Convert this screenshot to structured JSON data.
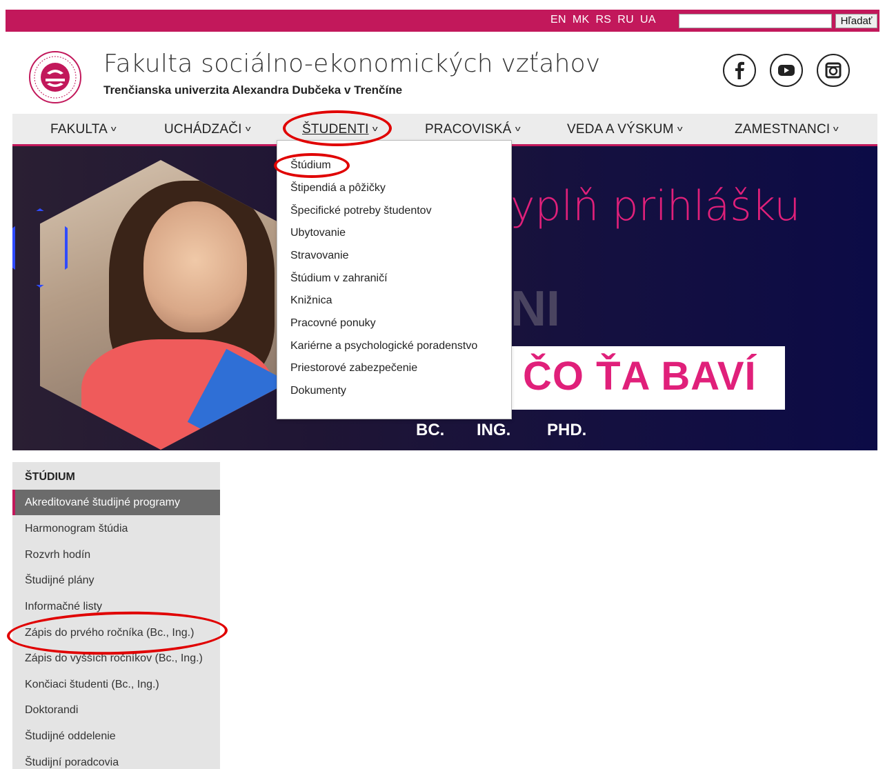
{
  "topbar": {
    "languages": [
      "EN",
      "MK",
      "RS",
      "RU",
      "UA"
    ],
    "search_value": "",
    "search_button": "Hľadať"
  },
  "header": {
    "title": "Fakulta sociálno-ekonomických vzťahov",
    "subtitle": "Trenčianska univerzita Alexandra Dubčeka v Trenčíne",
    "social_icons": [
      "facebook-icon",
      "youtube-icon",
      "instagram-icon"
    ]
  },
  "nav": {
    "items": [
      "FAKULTA",
      "UCHÁDZAČI",
      "ŠTUDENTI",
      "PRACOVISKÁ",
      "VEDA A VÝSKUM",
      "ZAMESTNANCI"
    ],
    "active": "ŠTUDENTI"
  },
  "dropdown": {
    "items": [
      "Štúdium",
      "Štipendiá a pôžičky",
      "Špecifické potreby študentov",
      "Ubytovanie",
      "Stravovanie",
      "Štúdium v zahraničí",
      "Knižnica",
      "Pracovné ponuky",
      "Kariérne a psychologické poradenstvo",
      "Priestorové zabezpečenie",
      "Dokumenty"
    ]
  },
  "hero": {
    "headline": "yplň prihlášku",
    "ghost_text": "NI",
    "box_text": "ČO ŤA BAVÍ",
    "degrees": [
      "BC.",
      "ING.",
      "PHD."
    ]
  },
  "sidebar": {
    "title": "ŠTÚDIUM",
    "active_item": "Akreditované študijné programy",
    "items": [
      "Harmonogram štúdia",
      "Rozvrh hodín",
      "Študijné plány",
      "Informačné listy",
      "Zápis do prvého ročníka (Bc., Ing.)",
      "Zápis do vyšších ročníkov (Bc., Ing.)",
      "Končiaci študenti (Bc., Ing.)",
      "Doktorandi",
      "Študijné oddelenie",
      "Študijní poradcovia"
    ]
  },
  "colors": {
    "brand": "#c2185b",
    "hero_accent": "#e0207a",
    "annotation": "#e00000"
  }
}
